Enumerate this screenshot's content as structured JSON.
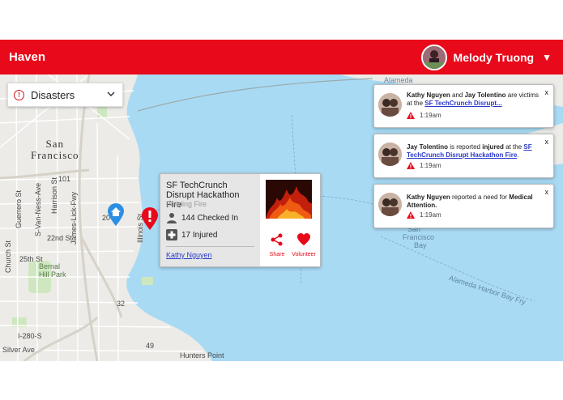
{
  "header": {
    "brand": "Haven",
    "user_name": "Melody Truong"
  },
  "map": {
    "city_line1": "San",
    "city_line2": "Francisco",
    "labels": {
      "n101": "101",
      "n280": "I-280-S",
      "silver_ave": "Silver Ave",
      "hunters_point": "Hunters Point",
      "bernal": "Bernal",
      "hill_park": "Hill Park",
      "s22": "22nd St",
      "s25": "25th St",
      "church": "Church St",
      "guerrero": "Guerrero St",
      "svan_ness": "S-Van-Ness-Ave",
      "harrison": "Harrison St",
      "jamestown": "James-Lick-Fwy",
      "illinois": "Illinois St",
      "sf_bay_1": "San",
      "sf_bay_2": "Francisco",
      "sf_bay_3": "Bay",
      "alameda": "Alameda Harbor Bay Fry",
      "alameda_top": "Alameda",
      "num_49": "49",
      "num_20": "20",
      "num_32": "32"
    }
  },
  "filter": {
    "label": "Disasters"
  },
  "popup": {
    "title": "SF TechCrunch Disrupt Hackathon Fire",
    "subtitle": "Building Fire",
    "checked_in": "144 Checked In",
    "injured": "17 Injured",
    "contact": "Kathy Nguyen",
    "share_label": "Share",
    "volunteer_label": "Volunteer"
  },
  "notifications": [
    {
      "name1": "Kathy Nguyen",
      "mid": " and ",
      "name2": "Jay Tolentino",
      "tail": " are victims at the ",
      "link": "SF TechCrunch Disrupt...",
      "time": "1:19am",
      "close": "x"
    },
    {
      "name1": "Jay Tolentino",
      "mid": " is reported ",
      "status": "injured",
      "tail": " at the ",
      "link": "SF TechCrunch Disrupt Hackathon Fire",
      "end": ".",
      "time": "1:19am",
      "close": "x"
    },
    {
      "name1": "Kathy Nguyen",
      "mid": " reported a need for ",
      "need": "Medical Attention.",
      "time": "1:19am",
      "close": "x"
    }
  ]
}
